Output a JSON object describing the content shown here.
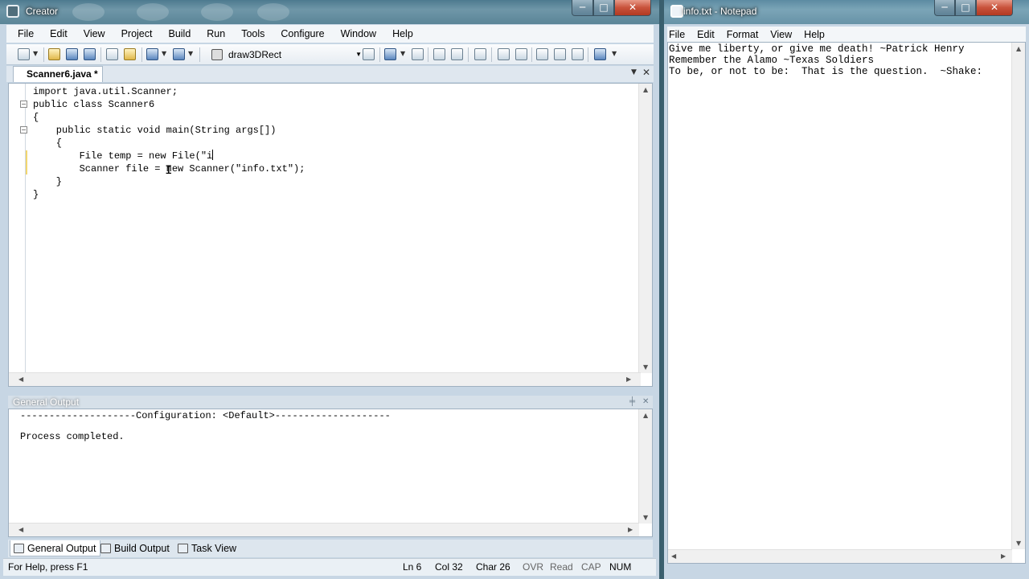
{
  "jcreator": {
    "title": "Creator",
    "window_buttons": [
      "─",
      "□",
      "✕"
    ],
    "menu": [
      "File",
      "Edit",
      "View",
      "Project",
      "Build",
      "Run",
      "Tools",
      "Configure",
      "Window",
      "Help"
    ],
    "toolbar": {
      "target_combo": "draw3DRect"
    },
    "document_tab": "Scanner6.java *",
    "code_lines": [
      "import java.util.Scanner;",
      "public class Scanner6",
      "{",
      "    public static void main(String args[])",
      "    {",
      "        File temp = new File(\"i",
      "        Scanner file = new Scanner(\"info.txt\");",
      "    }",
      "}"
    ],
    "output_panel": {
      "title": "General Output",
      "lines": [
        "--------------------Configuration: <Default>--------------------",
        "Process completed."
      ],
      "tabs": [
        "General Output",
        "Build Output",
        "Task View"
      ]
    },
    "statusbar": {
      "help": "For Help, press F1",
      "ln": "Ln 6",
      "col": "Col 32",
      "char": "Char 26",
      "ovr": "OVR",
      "read": "Read",
      "cap": "CAP",
      "num": "NUM"
    }
  },
  "notepad": {
    "title": "info.txt - Notepad",
    "window_buttons": [
      "─",
      "□",
      "✕"
    ],
    "menu": [
      "File",
      "Edit",
      "Format",
      "View",
      "Help"
    ],
    "lines": [
      "Give me liberty, or give me death! ~Patrick Henry",
      "Remember the Alamo ~Texas Soldiers",
      "To be, or not to be:  That is the question.  ~Shake:"
    ]
  }
}
